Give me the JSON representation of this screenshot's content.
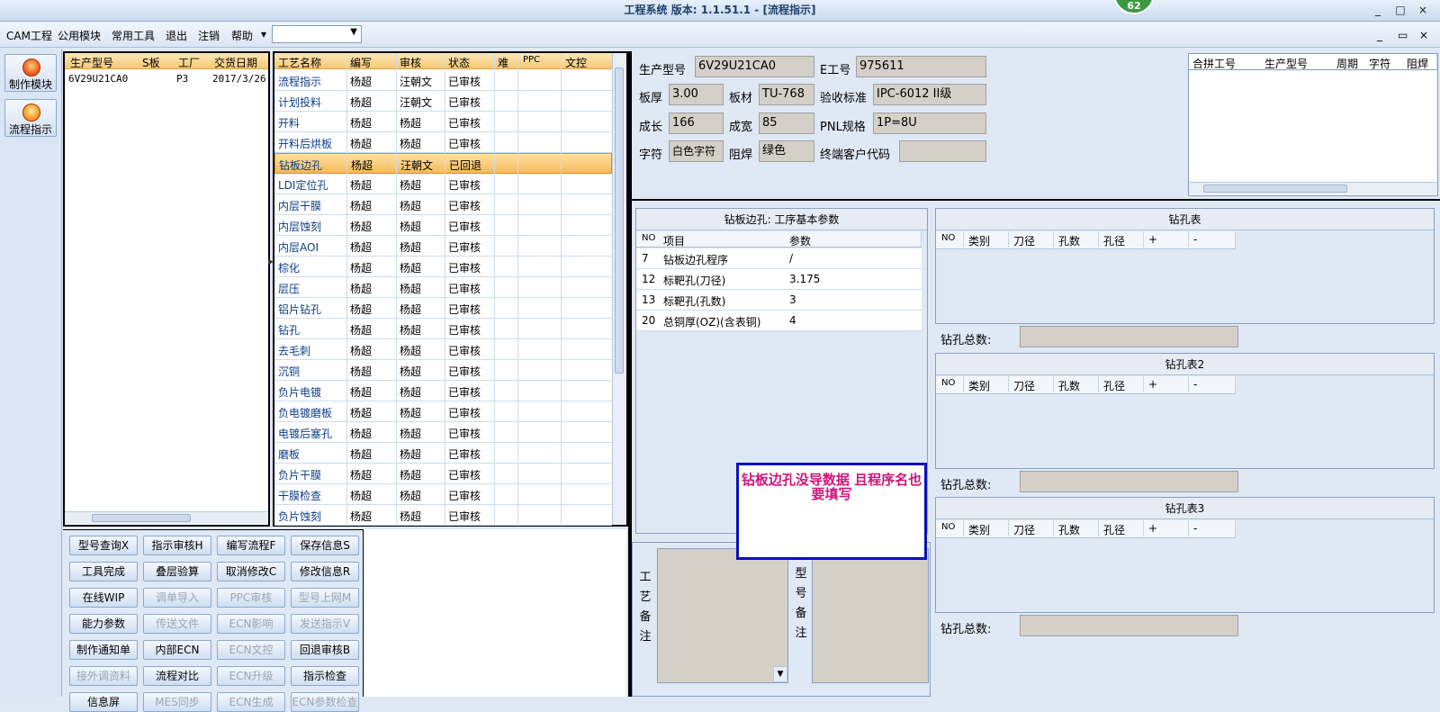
{
  "title": "工程系统  版本: 1.1.51.1 - [流程指示]",
  "badge": "62",
  "window_controls": {
    "minimize": "_",
    "restore": "□",
    "close": "×"
  },
  "menu": {
    "items": [
      "CAM工程",
      "公用模块",
      "常用工具",
      "退出",
      "注销",
      "帮助"
    ],
    "dropdown_arrow": "▾",
    "combo_value": "",
    "mdi_controls": [
      "_",
      "▭",
      "×"
    ]
  },
  "sidebar": {
    "buttons": [
      {
        "label": "制作模块",
        "icon": "fire-icon"
      },
      {
        "label": "流程指示",
        "icon": "flow-icon"
      }
    ]
  },
  "order_grid": {
    "columns": [
      "生产型号",
      "S板",
      "工厂",
      "交货日期"
    ],
    "rows": [
      [
        "6V29U21CA0",
        "",
        "P3",
        "2017/3/26"
      ]
    ]
  },
  "process_grid": {
    "columns": [
      "工艺名称",
      "编写",
      "审核",
      "状态",
      "难",
      "PPC",
      "文控"
    ],
    "rows": [
      [
        "流程指示",
        "杨超",
        "汪朝文",
        "已审核"
      ],
      [
        "计划投料",
        "杨超",
        "汪朝文",
        "已审核"
      ],
      [
        "开料",
        "杨超",
        "杨超",
        "已审核"
      ],
      [
        "开料后烘板",
        "杨超",
        "杨超",
        "已审核"
      ],
      [
        "钻板边孔",
        "杨超",
        "汪朝文",
        "已回退"
      ],
      [
        "LDI定位孔",
        "杨超",
        "杨超",
        "已审核"
      ],
      [
        "内层干膜",
        "杨超",
        "杨超",
        "已审核"
      ],
      [
        "内层蚀刻",
        "杨超",
        "杨超",
        "已审核"
      ],
      [
        "内层AOI",
        "杨超",
        "杨超",
        "已审核"
      ],
      [
        "棕化",
        "杨超",
        "杨超",
        "已审核"
      ],
      [
        "层压",
        "杨超",
        "杨超",
        "已审核"
      ],
      [
        "铝片钻孔",
        "杨超",
        "杨超",
        "已审核"
      ],
      [
        "钻孔",
        "杨超",
        "杨超",
        "已审核"
      ],
      [
        "去毛刺",
        "杨超",
        "杨超",
        "已审核"
      ],
      [
        "沉铜",
        "杨超",
        "杨超",
        "已审核"
      ],
      [
        "负片电镀",
        "杨超",
        "杨超",
        "已审核"
      ],
      [
        "负电镀磨板",
        "杨超",
        "杨超",
        "已审核"
      ],
      [
        "电镀后塞孔",
        "杨超",
        "杨超",
        "已审核"
      ],
      [
        "磨板",
        "杨超",
        "杨超",
        "已审核"
      ],
      [
        "负片干膜",
        "杨超",
        "杨超",
        "已审核"
      ],
      [
        "干膜检查",
        "杨超",
        "杨超",
        "已审核"
      ],
      [
        "负片蚀刻",
        "杨超",
        "杨超",
        "已审核"
      ]
    ],
    "selected_index": 4
  },
  "buttons": [
    [
      "型号查询X",
      "指示审核H",
      "编写流程F",
      "保存信息S"
    ],
    [
      "工具完成",
      "叠层验算",
      "取消修改C",
      "修改信息R"
    ],
    [
      "在线WIP",
      "调单导入",
      "PPC审核",
      "型号上网M"
    ],
    [
      "能力参数",
      "传送文件",
      "ECN影响",
      "发送指示V"
    ],
    [
      "制作通知单",
      "内部ECN",
      "ECN文控",
      "回退审核B"
    ],
    [
      "接外调资料",
      "流程对比",
      "ECN升级",
      "指示检查"
    ],
    [
      "信息屏",
      "MES同步",
      "ECN生成",
      "ECN参数检查"
    ]
  ],
  "disabled_buttons": [
    "调单导入",
    "PPC审核",
    "型号上网M",
    "传送文件",
    "ECN影响",
    "发送指示V",
    "ECN文控",
    "接外调资料",
    "ECN升级",
    "MES同步",
    "ECN生成",
    "ECN参数检查"
  ],
  "info": {
    "model_label": "生产型号",
    "model": "6V29U21CA0",
    "eno_label": "E工号",
    "eno": "975611",
    "thickness_label": "板厚",
    "thickness": "3.00",
    "material_label": "板材",
    "material": "TU-768",
    "standard_label": "验收标准",
    "standard": "IPC-6012 II级",
    "length_label": "成长",
    "length": "166",
    "width_label": "成宽",
    "width": "85",
    "pnl_label": "PNL规格",
    "pnl": "1P=8U",
    "char_label": "字符",
    "char": "白色字符",
    "mask_label": "阻焊",
    "mask": "绿色",
    "customer_label": "终端客户代码",
    "customer": ""
  },
  "merge_grid": {
    "columns": [
      "合拼工号",
      "生产型号",
      "周期",
      "字符",
      "阻焊"
    ]
  },
  "params": {
    "title": "钻板边孔: 工序基本参数",
    "columns": [
      "NO",
      "项目",
      "参数"
    ],
    "rows": [
      [
        "7",
        "钻板边孔程序",
        "/"
      ],
      [
        "12",
        "标靶孔(刀径)",
        "3.175"
      ],
      [
        "13",
        "标靶孔(孔数)",
        "3"
      ],
      [
        "20",
        "总铜厚(OZ)(含表铜)",
        "4"
      ]
    ]
  },
  "drill_tables": [
    {
      "title": "钻孔表",
      "columns": [
        "NO",
        "类别",
        "刀径",
        "孔数",
        "孔径",
        "+",
        "-"
      ],
      "total_label": "钻孔总数:",
      "total": ""
    },
    {
      "title": "钻孔表2",
      "columns": [
        "NO",
        "类别",
        "刀径",
        "孔数",
        "孔径",
        "+",
        "-"
      ],
      "total_label": "钻孔总数:",
      "total": ""
    },
    {
      "title": "钻孔表3",
      "columns": [
        "NO",
        "类别",
        "刀径",
        "孔数",
        "孔径",
        "+",
        "-"
      ],
      "total_label": "钻孔总数:",
      "total": ""
    }
  ],
  "remarks": {
    "process_label": "工艺备注",
    "model_label": "型号备注"
  },
  "annotation": "钻板边孔没导数据   且程序名也要填写",
  "colors": {
    "accent": "#f6b95a",
    "annotation_border": "#0a12b8",
    "annotation_text": "#d0157a",
    "badge": "#3a9a3e"
  }
}
